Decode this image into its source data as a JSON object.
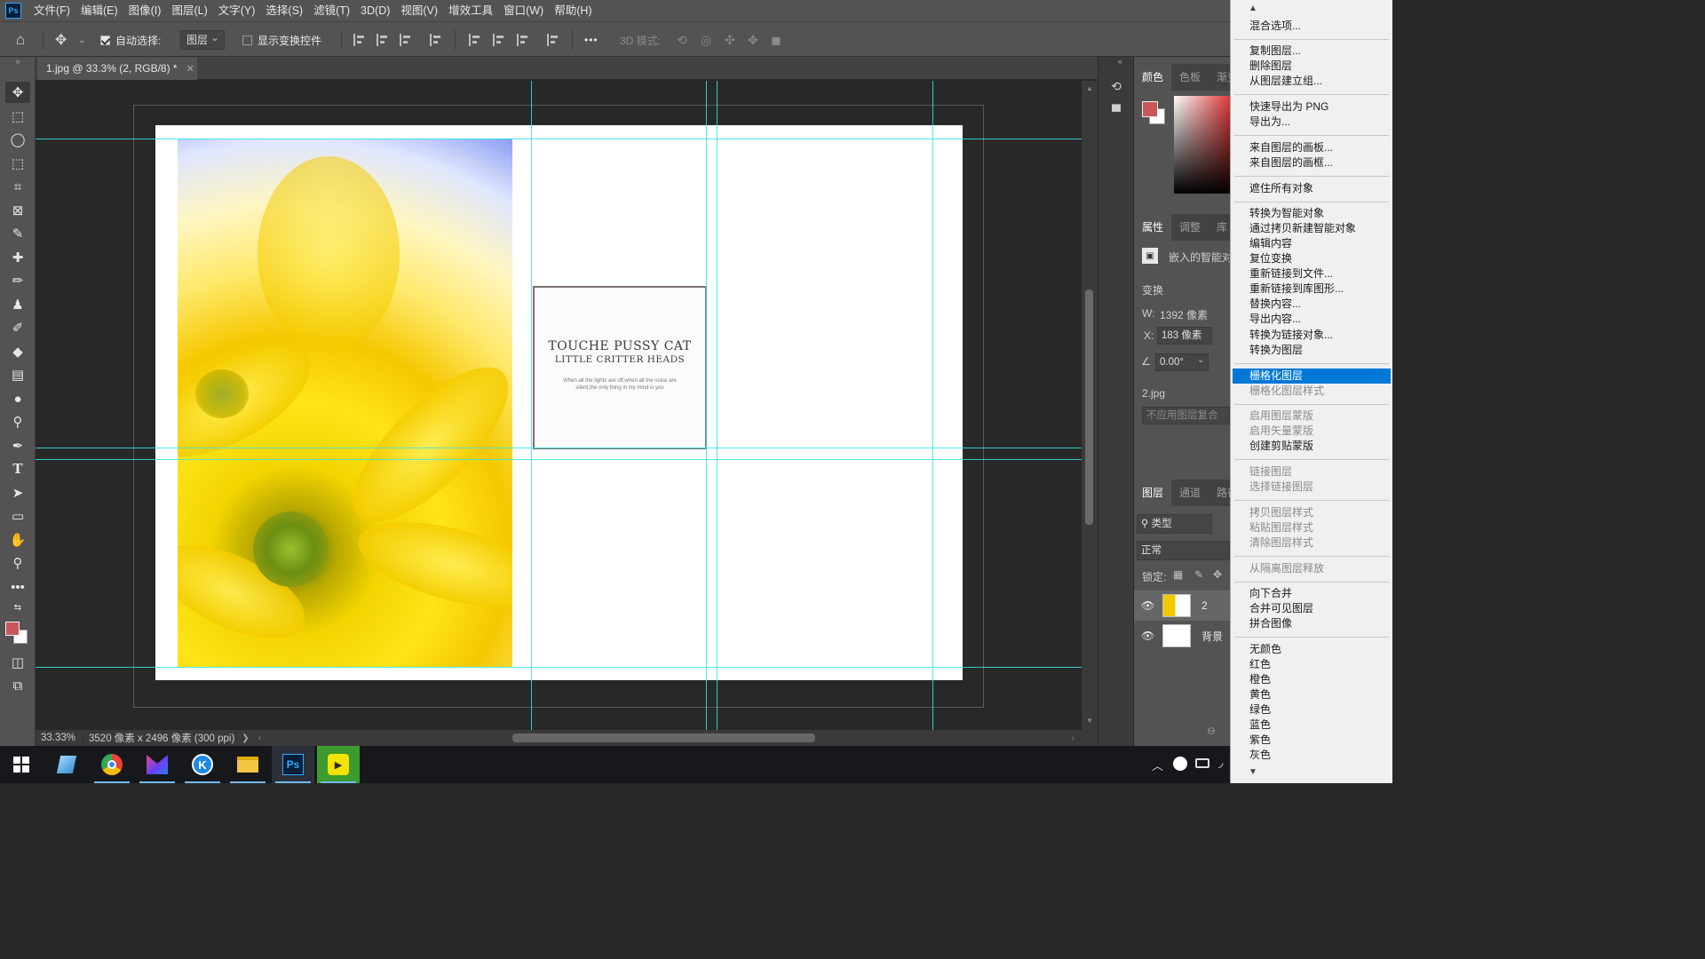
{
  "app": {
    "logo_text": "Ps"
  },
  "menubar": {
    "items": [
      "文件(F)",
      "编辑(E)",
      "图像(I)",
      "图层(L)",
      "文字(Y)",
      "选择(S)",
      "滤镜(T)",
      "3D(D)",
      "视图(V)",
      "增效工具",
      "窗口(W)",
      "帮助(H)"
    ]
  },
  "options": {
    "auto_select_label": "自动选择:",
    "auto_select_checked": true,
    "auto_select_value": "图层",
    "show_transform_label": "显示变换控件",
    "show_transform_checked": false,
    "more_label": "•••",
    "mode_3d_label": "3D 模式:"
  },
  "document": {
    "tab_title": "1.jpg @ 33.3% (2, RGB/8) *",
    "card_title": "TOUCHE PUSSY CAT",
    "card_subtitle": "LITTLE CRITTER HEADS",
    "card_body": "When all the lights are off,when all the noise are silent,the only thing in my mind is you"
  },
  "status": {
    "zoom": "33.33%",
    "info": "3520 像素 x 2496 像素 (300 ppi)",
    "arrow": "❯"
  },
  "panels": {
    "color_tabs": [
      "颜色",
      "色板",
      "渐变"
    ],
    "foreground_color": "#c8585a",
    "background_color": "#ffffff",
    "props_tabs": [
      "属性",
      "调整",
      "库"
    ],
    "smart_object_label": "嵌入的智能对象",
    "transform_label": "变换",
    "w_label": "W:",
    "w_value": "1392 像素",
    "x_label": "X:",
    "x_value": "183 像素",
    "angle_value": "0.00°",
    "linked_file": "2.jpg",
    "comp_placeholder": "不应用图层复合",
    "layers_tabs": [
      "图层",
      "通道",
      "路径"
    ],
    "filter_type": "类型",
    "blend_mode": "正常",
    "lock_label": "锁定:",
    "layers": [
      {
        "name": "2",
        "visible": true,
        "selected": true
      },
      {
        "name": "背景",
        "visible": true,
        "selected": false
      }
    ]
  },
  "context_menu": {
    "items": [
      {
        "label": "混合选项...",
        "state": "normal"
      },
      {
        "label": "复制图层...",
        "state": "normal"
      },
      {
        "label": "删除图层",
        "state": "normal"
      },
      {
        "label": "从图层建立组...",
        "state": "normal"
      },
      {
        "label": "快速导出为 PNG",
        "state": "normal"
      },
      {
        "label": "导出为...",
        "state": "normal"
      },
      {
        "label": "来自图层的画板...",
        "state": "normal"
      },
      {
        "label": "来自图层的画框...",
        "state": "normal"
      },
      {
        "label": "遮住所有对象",
        "state": "normal"
      },
      {
        "label": "转换为智能对象",
        "state": "normal"
      },
      {
        "label": "通过拷贝新建智能对象",
        "state": "normal"
      },
      {
        "label": "编辑内容",
        "state": "normal"
      },
      {
        "label": "复位变换",
        "state": "normal"
      },
      {
        "label": "重新链接到文件...",
        "state": "normal"
      },
      {
        "label": "重新链接到库图形...",
        "state": "normal"
      },
      {
        "label": "替换内容...",
        "state": "normal"
      },
      {
        "label": "导出内容...",
        "state": "normal"
      },
      {
        "label": "转换为链接对象...",
        "state": "normal"
      },
      {
        "label": "转换为图层",
        "state": "normal"
      },
      {
        "label": "栅格化图层",
        "state": "highlighted"
      },
      {
        "label": "栅格化图层样式",
        "state": "disabled"
      },
      {
        "label": "启用图层蒙版",
        "state": "disabled"
      },
      {
        "label": "启用矢量蒙版",
        "state": "disabled"
      },
      {
        "label": "创建剪贴蒙版",
        "state": "normal"
      },
      {
        "label": "链接图层",
        "state": "disabled"
      },
      {
        "label": "选择链接图层",
        "state": "disabled"
      },
      {
        "label": "拷贝图层样式",
        "state": "disabled"
      },
      {
        "label": "粘贴图层样式",
        "state": "disabled"
      },
      {
        "label": "清除图层样式",
        "state": "disabled"
      },
      {
        "label": "从隔离图层释放",
        "state": "disabled"
      },
      {
        "label": "向下合并",
        "state": "normal"
      },
      {
        "label": "合并可见图层",
        "state": "normal"
      },
      {
        "label": "拼合图像",
        "state": "normal"
      },
      {
        "label": "无颜色",
        "state": "normal"
      },
      {
        "label": "红色",
        "state": "normal"
      },
      {
        "label": "橙色",
        "state": "normal"
      },
      {
        "label": "黄色",
        "state": "normal"
      },
      {
        "label": "绿色",
        "state": "normal"
      },
      {
        "label": "蓝色",
        "state": "normal"
      },
      {
        "label": "紫色",
        "state": "normal"
      },
      {
        "label": "灰色",
        "state": "normal"
      }
    ]
  },
  "taskbar": {
    "apps": [
      "windows-start",
      "notepad",
      "chrome",
      "vscode",
      "k-app",
      "file-explorer",
      "photoshop",
      "media-player"
    ],
    "ps_label": "Ps",
    "k_label": "K"
  },
  "colors": {
    "guide": "#33e6e6",
    "menu_highlight": "#0078d7",
    "ps_blue": "#31a8ff"
  }
}
